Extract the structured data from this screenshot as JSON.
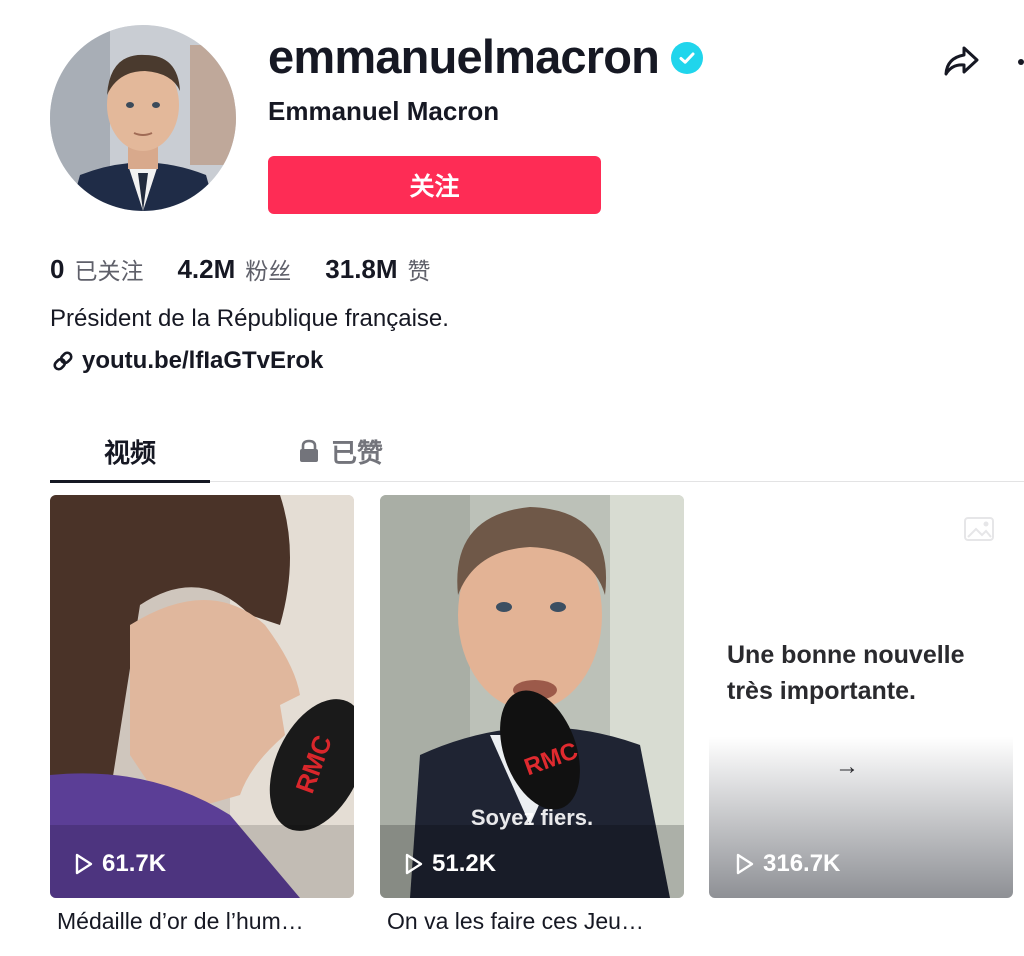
{
  "profile": {
    "username": "emmanuelmacron",
    "nickname": "Emmanuel Macron",
    "verified": true,
    "follow_label": "关注",
    "bio": "Président de la République française.",
    "link": "youtu.be/lfIaGTvErok",
    "icons": {
      "verified": "verified-check-icon",
      "share": "share-arrow-icon",
      "more": "more-dots-icon",
      "link": "link-chain-icon"
    }
  },
  "stats": [
    {
      "number": "0",
      "label": "已关注"
    },
    {
      "number": "4.2M",
      "label": "粉丝"
    },
    {
      "number": "31.8M",
      "label": "赞"
    }
  ],
  "tabs": [
    {
      "label": "视频",
      "active": true
    },
    {
      "label": "已赞",
      "locked": true
    }
  ],
  "videos": [
    {
      "views": "61.7K",
      "caption": "Médaille d’or de l’hum…",
      "overlay": ""
    },
    {
      "views": "51.2K",
      "caption": "On va les faire ces Jeu…",
      "overlay": "Soyez fiers."
    },
    {
      "views": "316.7K",
      "caption": "",
      "text_line1": "Une bonne nouvelle",
      "text_line2": "très importante.",
      "arrow": "→"
    }
  ],
  "colors": {
    "accent": "#fe2c55",
    "verified": "#20d5ec",
    "text": "#161823",
    "muted": "#5f606a"
  }
}
